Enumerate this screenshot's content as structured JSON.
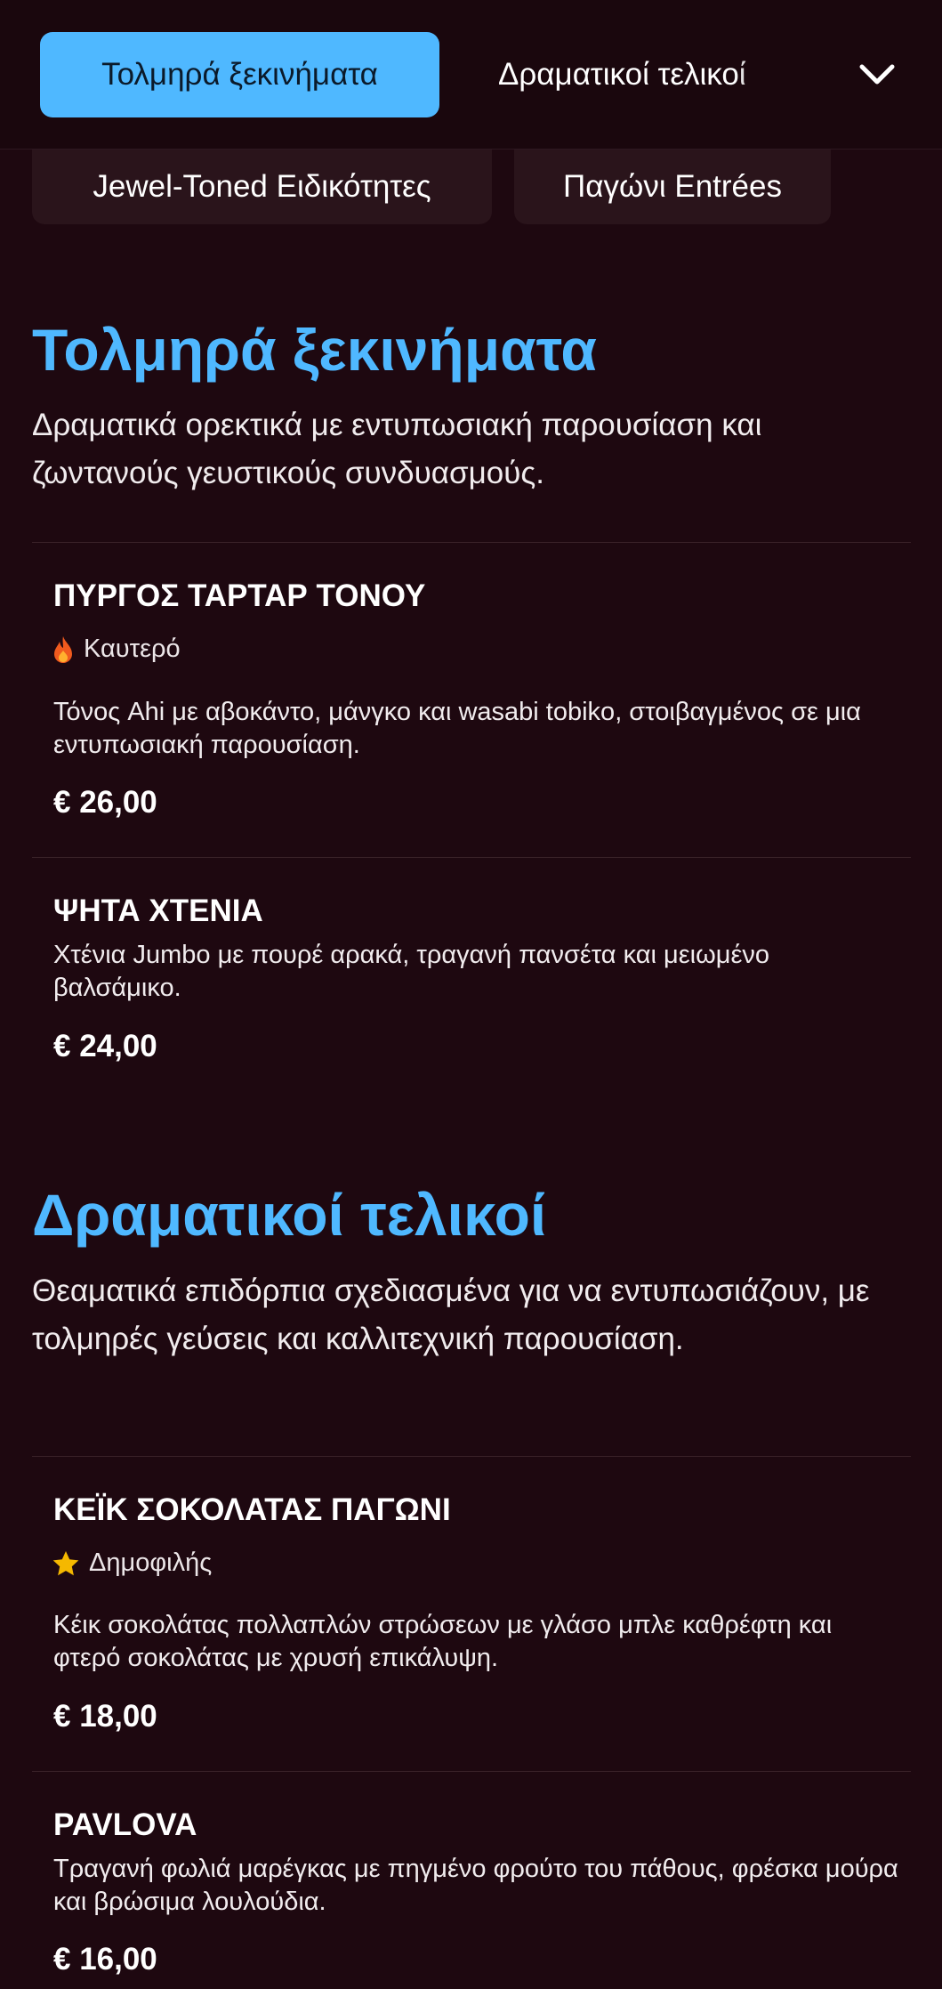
{
  "nav": {
    "tabs": [
      {
        "label": "Τολμηρά ξεκινήματα",
        "active": true
      },
      {
        "label": "Δραματικοί τελικοί",
        "active": false
      }
    ],
    "more_icon": "chevron-down-icon",
    "categories": [
      {
        "label": "Jewel-Toned Ειδικότητες"
      },
      {
        "label": "Παγώνι Entrées"
      }
    ]
  },
  "colors": {
    "background": "#1e0810",
    "accent": "#4fb8ff",
    "card": "#2a141b"
  },
  "sections": [
    {
      "title": "Τολμηρά ξεκινήματα",
      "description": "Δραματικά ορεκτικά με εντυπωσιακή παρουσίαση και ζωντανούς γευστικούς συνδυασμούς.",
      "items": [
        {
          "name": "ΠΥΡΓΟΣ ΤΑΡΤΑΡ ΤΟΝΟΥ",
          "badge": {
            "icon": "flame-icon",
            "label": "Καυτερό"
          },
          "description": "Τόνος Ahi με αβοκάντο, μάνγκο και wasabi tobiko, στοιβαγμένος σε μια εντυπωσιακή παρουσίαση.",
          "price": "€ 26,00"
        },
        {
          "name": "ΨΗΤΑ ΧΤΕΝΙΑ",
          "description": "Χτένια Jumbo με πουρέ αρακά, τραγανή πανσέτα και μειωμένο βαλσάμικο.",
          "price": "€ 24,00"
        }
      ]
    },
    {
      "title": "Δραματικοί τελικοί",
      "description": "Θεαματικά επιδόρπια σχεδιασμένα για να εντυπωσιάζουν, με τολμηρές γεύσεις και καλλιτεχνική παρουσίαση.",
      "items": [
        {
          "name": "ΚΕΪΚ ΣΟΚΟΛΑΤΑΣ ΠΑΓΩΝΙ",
          "badge": {
            "icon": "star-icon",
            "label": "Δημοφιλής"
          },
          "description": "Κέικ σοκολάτας πολλαπλών στρώσεων με γλάσο μπλε καθρέφτη και φτερό σοκολάτας με χρυσή επικάλυψη.",
          "price": "€ 18,00"
        },
        {
          "name": "PAVLOVA",
          "description": "Τραγανή φωλιά μαρέγκας με πηγμένο φρούτο του πάθους, φρέσκα μούρα και βρώσιμα λουλούδια.",
          "price": "€ 16,00"
        }
      ]
    }
  ]
}
